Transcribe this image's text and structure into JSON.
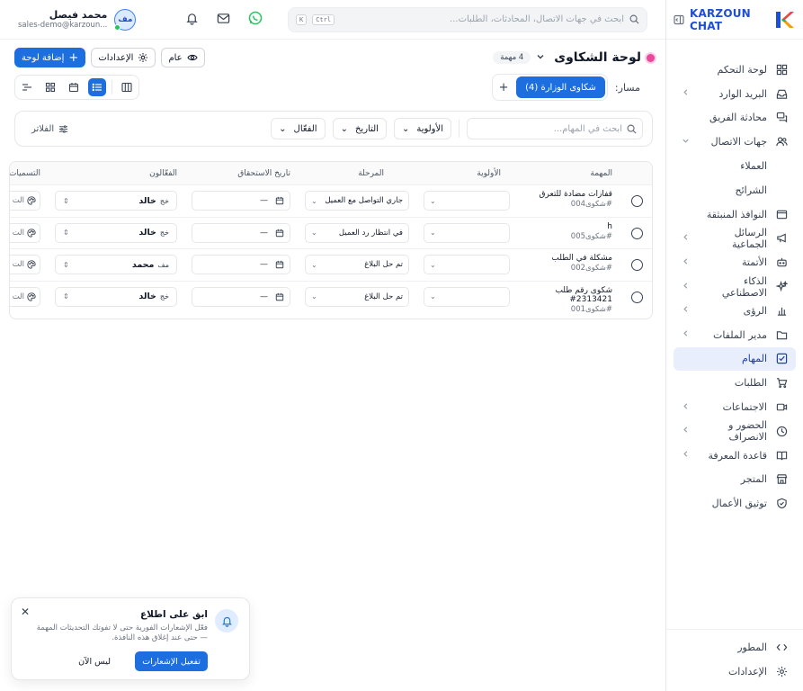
{
  "brand": {
    "name": "KARZOUN CHAT"
  },
  "sidebar": {
    "items": [
      {
        "label": "لوحة التحكم",
        "icon": "dashboard-icon",
        "chevron": false
      },
      {
        "label": "البريد الوارد",
        "icon": "inbox-icon",
        "chevron": true
      },
      {
        "label": "محادثة الفريق",
        "icon": "team-chat-icon",
        "chevron": false
      },
      {
        "label": "جهات الاتصال",
        "icon": "contacts-icon",
        "chevron": true,
        "expanded": true
      },
      {
        "label": "العملاء",
        "icon": "",
        "chevron": false,
        "sub": true
      },
      {
        "label": "الشرائح",
        "icon": "",
        "chevron": false,
        "sub": true
      },
      {
        "label": "النوافذ المنبثقة",
        "icon": "popup-icon",
        "chevron": false
      },
      {
        "label": "الرسائل الجماعية",
        "icon": "megaphone-icon",
        "chevron": true
      },
      {
        "label": "الأتمتة",
        "icon": "bot-icon",
        "chevron": true
      },
      {
        "label": "الذكاء الاصطناعي",
        "icon": "sparkles-icon",
        "chevron": true
      },
      {
        "label": "الرؤى",
        "icon": "chart-icon",
        "chevron": true
      },
      {
        "label": "مدير الملفات",
        "icon": "folder-icon",
        "chevron": true
      },
      {
        "label": "المهام",
        "icon": "task-check-icon",
        "chevron": false,
        "active": true
      },
      {
        "label": "الطلبات",
        "icon": "cart-icon",
        "chevron": false
      },
      {
        "label": "الاجتماعات",
        "icon": "video-icon",
        "chevron": true
      },
      {
        "label": "الحضور و الانصراف",
        "icon": "clock-icon",
        "chevron": true
      },
      {
        "label": "قاعدة المعرفة",
        "icon": "book-icon",
        "chevron": true
      },
      {
        "label": "المتجر",
        "icon": "store-icon",
        "chevron": false
      },
      {
        "label": "توثيق الأعمال",
        "icon": "shield-check-icon",
        "chevron": false
      }
    ],
    "bottom": [
      {
        "label": "المطور",
        "icon": "code-icon"
      },
      {
        "label": "الإعدادات",
        "icon": "gear-icon"
      }
    ]
  },
  "topbar": {
    "search_placeholder": "ابحث في جهات الاتصال، المحادثات، الطلبات...",
    "shortcut_ctrl": "Ctrl",
    "shortcut_key": "K",
    "user_name": "محمد فيصل",
    "user_email": "sales-demo@karzoun...",
    "user_initials": "مف"
  },
  "board": {
    "title": "لوحة الشكاوى",
    "task_count": "4 مهمة",
    "visibility": "عام",
    "settings_label": "الإعدادات",
    "add_board_label": "إضافة لوحة"
  },
  "path": {
    "label": "مسار:",
    "active_tab": "شكاوى الوزارة (4)",
    "add": "+"
  },
  "filters": {
    "search_placeholder": "ابحث في المهام...",
    "priority": "الأولوية",
    "date": "التاريخ",
    "assignee": "الفعّال",
    "clear": "الفلاتر"
  },
  "table": {
    "columns": {
      "task": "المهمة",
      "priority": "الأولوية",
      "stage": "المرحلة",
      "due_date": "تاريخ الاستحقاق",
      "assignees": "الفعّالون",
      "labels": "التسميات"
    },
    "rows": [
      {
        "title": "قفازات مضادة للتعرق",
        "id": "#شكوى004",
        "stage": "جاري التواصل مع العميل",
        "due": "—",
        "assignee_initials": "خج",
        "assignee": "خالد",
        "labels": "الت"
      },
      {
        "title": "h",
        "id": "#شكوى005",
        "stage": "في انتظار رد العميل",
        "due": "—",
        "assignee_initials": "خج",
        "assignee": "خالد",
        "labels": "الت"
      },
      {
        "title": "مشكلة في الطلب",
        "id": "#شكوى002",
        "stage": "تم حل البلاغ",
        "due": "—",
        "assignee_initials": "مف",
        "assignee": "محمد",
        "labels": "الت"
      },
      {
        "title": "شكوى رقم طلب 2313421#",
        "id": "#شكوى001",
        "stage": "تم حل البلاغ",
        "due": "—",
        "assignee_initials": "خج",
        "assignee": "خالد",
        "labels": "الت"
      }
    ]
  },
  "toast": {
    "title": "ابق على اطلاع",
    "message": "فعّل الإشعارات الفورية حتى لا تفوتك التحديثات المهمة — حتى عند إغلاق هذه النافذة.",
    "primary": "تفعيل الإشعارات",
    "secondary": "ليس الآن"
  },
  "colors": {
    "accent": "#1d6fe0",
    "board_dot": "#ec4899",
    "online": "#22c55e",
    "whatsapp": "#22c55e"
  }
}
